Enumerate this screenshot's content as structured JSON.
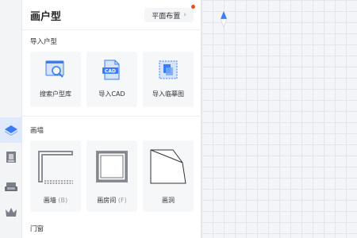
{
  "panel": {
    "title": "画户型",
    "plan_button": "平面布置",
    "plan_button_chevron": "›"
  },
  "sections": {
    "import": {
      "label": "导入户型",
      "cards": [
        {
          "label": "搜索户型库",
          "icon": "search-floorplan-icon"
        },
        {
          "label": "导入CAD",
          "icon": "cad-file-icon"
        },
        {
          "label": "导入临摹图",
          "icon": "trace-image-icon"
        }
      ],
      "cad_badge": "CAD"
    },
    "walls": {
      "label": "画墙",
      "cards": [
        {
          "label": "画墙",
          "shortcut": "(B)",
          "icon": "draw-wall-icon"
        },
        {
          "label": "画房间",
          "shortcut": "(F)",
          "icon": "draw-room-icon"
        },
        {
          "label": "画洞",
          "shortcut": "",
          "icon": "draw-hole-icon"
        }
      ]
    },
    "doors": {
      "label": "门窗"
    }
  },
  "rail": {
    "items": [
      {
        "icon": "floorplan-icon",
        "active": true
      },
      {
        "icon": "door-icon",
        "active": false
      },
      {
        "icon": "furniture-sofa-icon",
        "active": false
      },
      {
        "icon": "crown-icon",
        "active": false
      }
    ]
  },
  "colors": {
    "accent": "#3a7cf5",
    "notification": "#f04a22"
  }
}
